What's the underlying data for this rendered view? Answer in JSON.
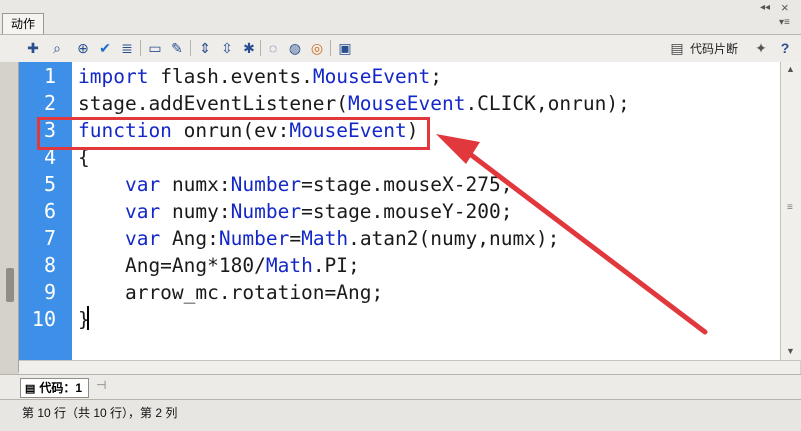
{
  "panel": {
    "title": "动作"
  },
  "window_controls": {
    "collapse": "◂◂",
    "close": "×",
    "menu": "▾≡"
  },
  "toolbar": {
    "icons": [
      "add-statement-icon",
      "find-icon",
      "target-icon",
      "check-syntax-icon",
      "auto-format-icon",
      "code-hint-icon",
      "debug-options-icon",
      "collapse-between-braces-icon",
      "collapse-selection-icon",
      "expand-all-icon",
      "apply-block-comment-icon",
      "apply-line-comment-icon",
      "remove-comment-icon",
      "show-hide-toolbox-icon"
    ],
    "snippet_label": "代码片断",
    "wand": "wand-icon",
    "help": "help-icon"
  },
  "editor": {
    "line_numbers": [
      "1",
      "2",
      "3",
      "4",
      "5",
      "6",
      "7",
      "8",
      "9",
      "10"
    ],
    "lines": [
      "import flash.events.MouseEvent;",
      "stage.addEventListener(MouseEvent.CLICK,onrun);",
      "function onrun(ev:MouseEvent)",
      "{",
      "    var numx:Number=stage.mouseX-275;",
      "    var numy:Number=stage.mouseY-200;",
      "    var Ang:Number=Math.atan2(numy,numx);",
      "    Ang=Ang*180/Math.PI;",
      "    arrow_mc.rotation=Ang;",
      "}"
    ],
    "annotation_color": "#e0383c",
    "line_number_bg": "#3d8fe8",
    "keyword_color": "#1428c8"
  },
  "bottom_tabs": {
    "code_tab": "代码：1"
  },
  "status": {
    "text": "第 10 行（共 10 行），第 2 列"
  }
}
